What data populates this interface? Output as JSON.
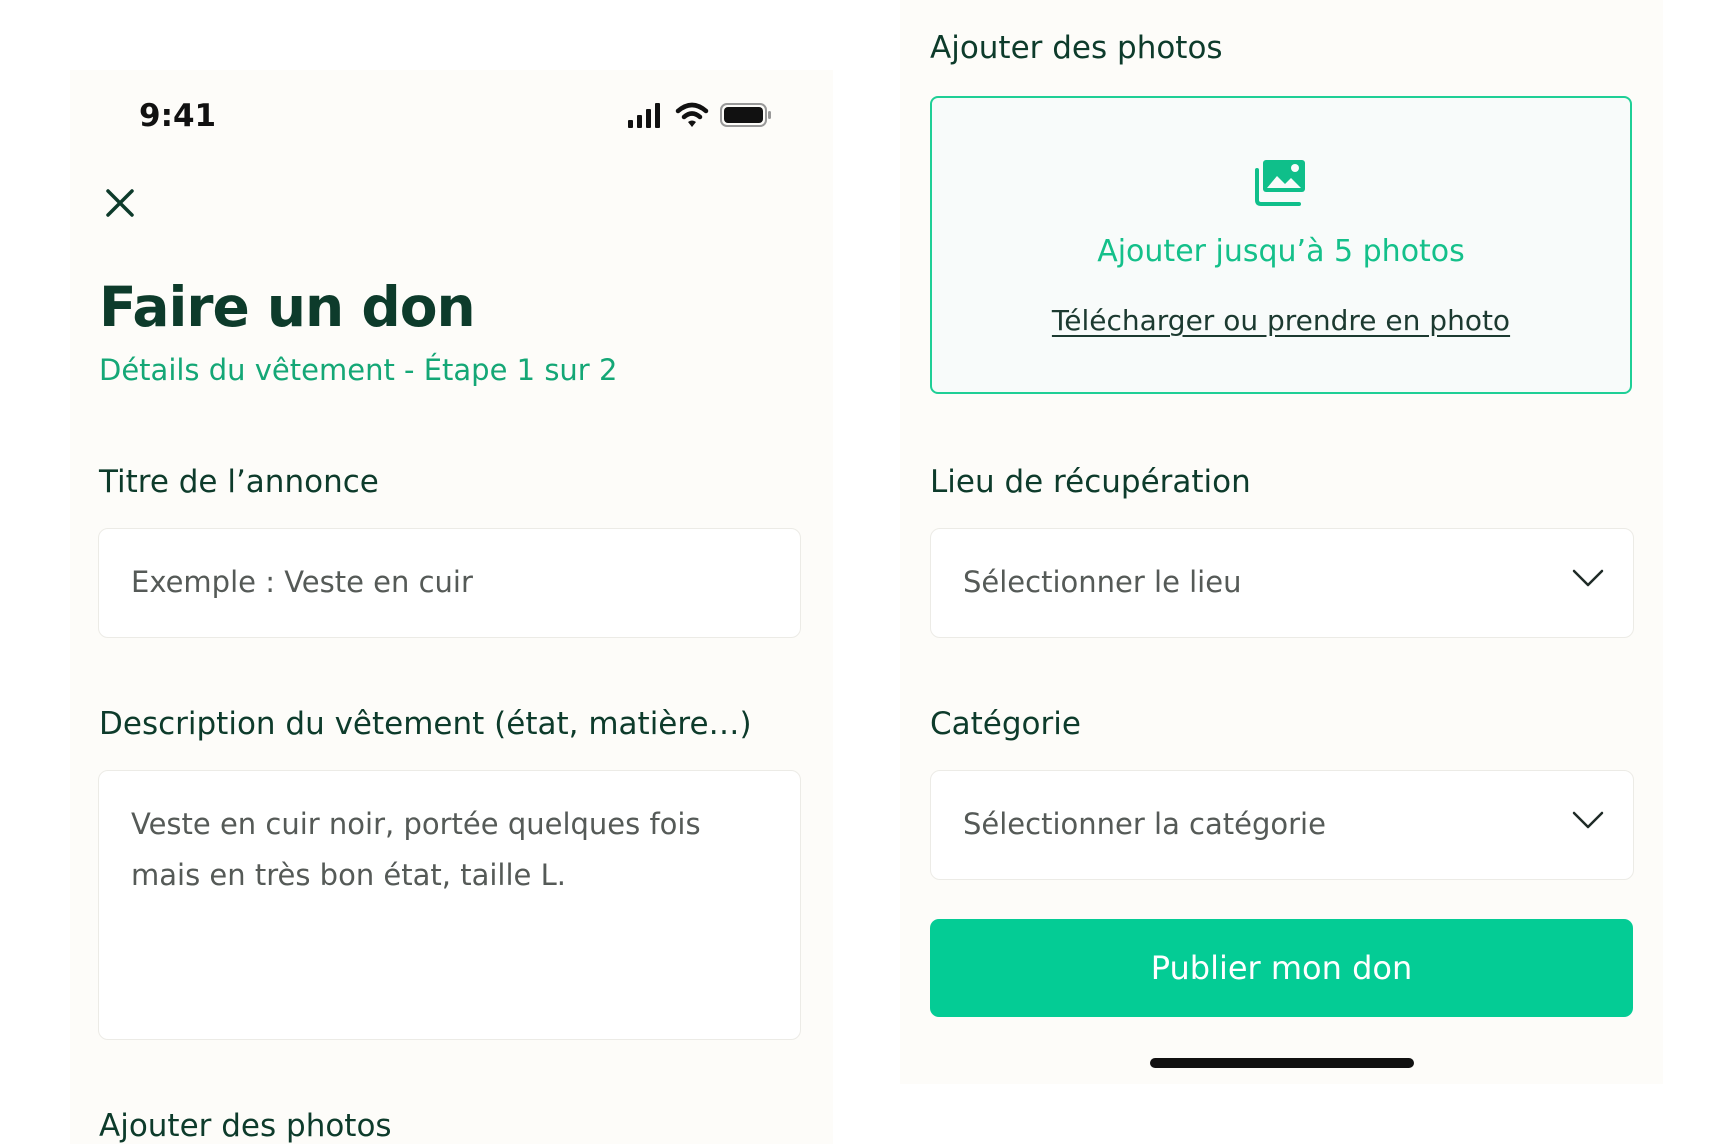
{
  "left": {
    "status_bar": {
      "time": "9:41"
    },
    "header": {
      "title": "Faire un don",
      "subtitle": "Détails du vêtement - Étape 1 sur 2"
    },
    "form": {
      "title_label": "Titre de l’annonce",
      "title_placeholder": "Exemple : Veste en cuir",
      "description_label": "Description du vêtement (état, matière…)",
      "description_placeholder": "Veste en cuir noir, portée quelques fois mais en très bon état, taille L.",
      "photos_label": "Ajouter des photos"
    }
  },
  "right": {
    "photos_label": "Ajouter des photos",
    "upload": {
      "main_text": "Ajouter jusqu’à 5 photos",
      "link_text": "Télécharger ou prendre en photo"
    },
    "location": {
      "label": "Lieu de récupération",
      "placeholder": "Sélectionner le lieu"
    },
    "category": {
      "label": "Catégorie",
      "placeholder": "Sélectionner la catégorie"
    },
    "publish_button": "Publier mon don"
  },
  "icons": {
    "close": "close-icon",
    "signal": "cellular-signal-icon",
    "wifi": "wifi-icon",
    "battery": "battery-icon",
    "photos": "image-gallery-icon",
    "chevron": "chevron-down-icon"
  },
  "colors": {
    "background": "#fdfcf9",
    "accent": "#04cc95",
    "accent_text": "#14a776",
    "heading": "#0d3b2b"
  }
}
